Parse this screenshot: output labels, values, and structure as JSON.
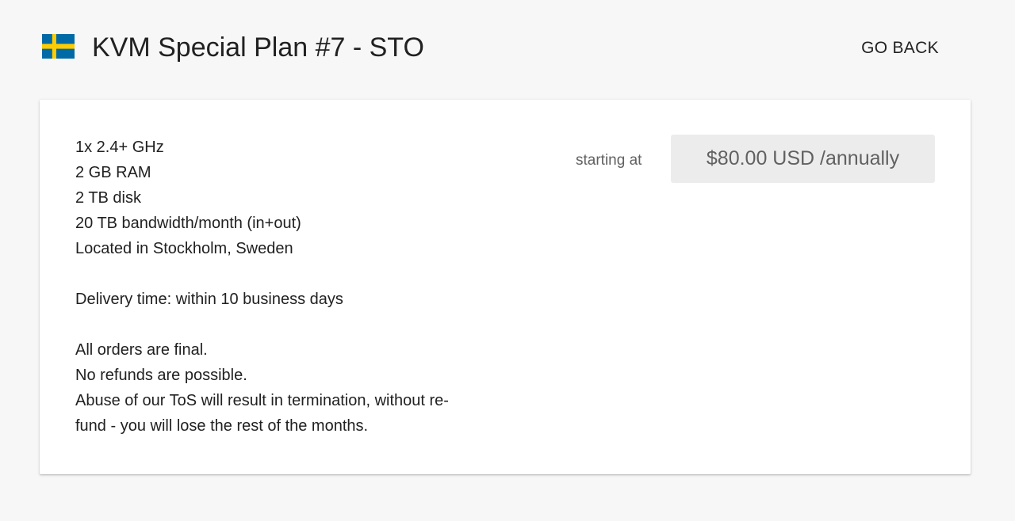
{
  "header": {
    "flag_icon": "sweden-flag-icon",
    "flag_colors": {
      "blue": "#006aa7",
      "yellow": "#fecc00"
    },
    "title": "KVM Special Plan #7 - STO",
    "go_back_label": "GO BACK"
  },
  "plan": {
    "description_lines": [
      "1x 2.4+ GHz",
      "2 GB RAM",
      "2 TB disk",
      "20 TB bandwidth/month (in+out)",
      "Located in Stockholm, Sweden",
      "",
      "Delivery time: within 10 business days",
      "",
      "All orders are final.",
      "No refunds are possible.",
      "Abuse of our ToS will result in termination, without re-",
      "fund - you will lose the rest of the months."
    ],
    "price_label": "starting at",
    "price": "$80.00 USD /annually"
  }
}
